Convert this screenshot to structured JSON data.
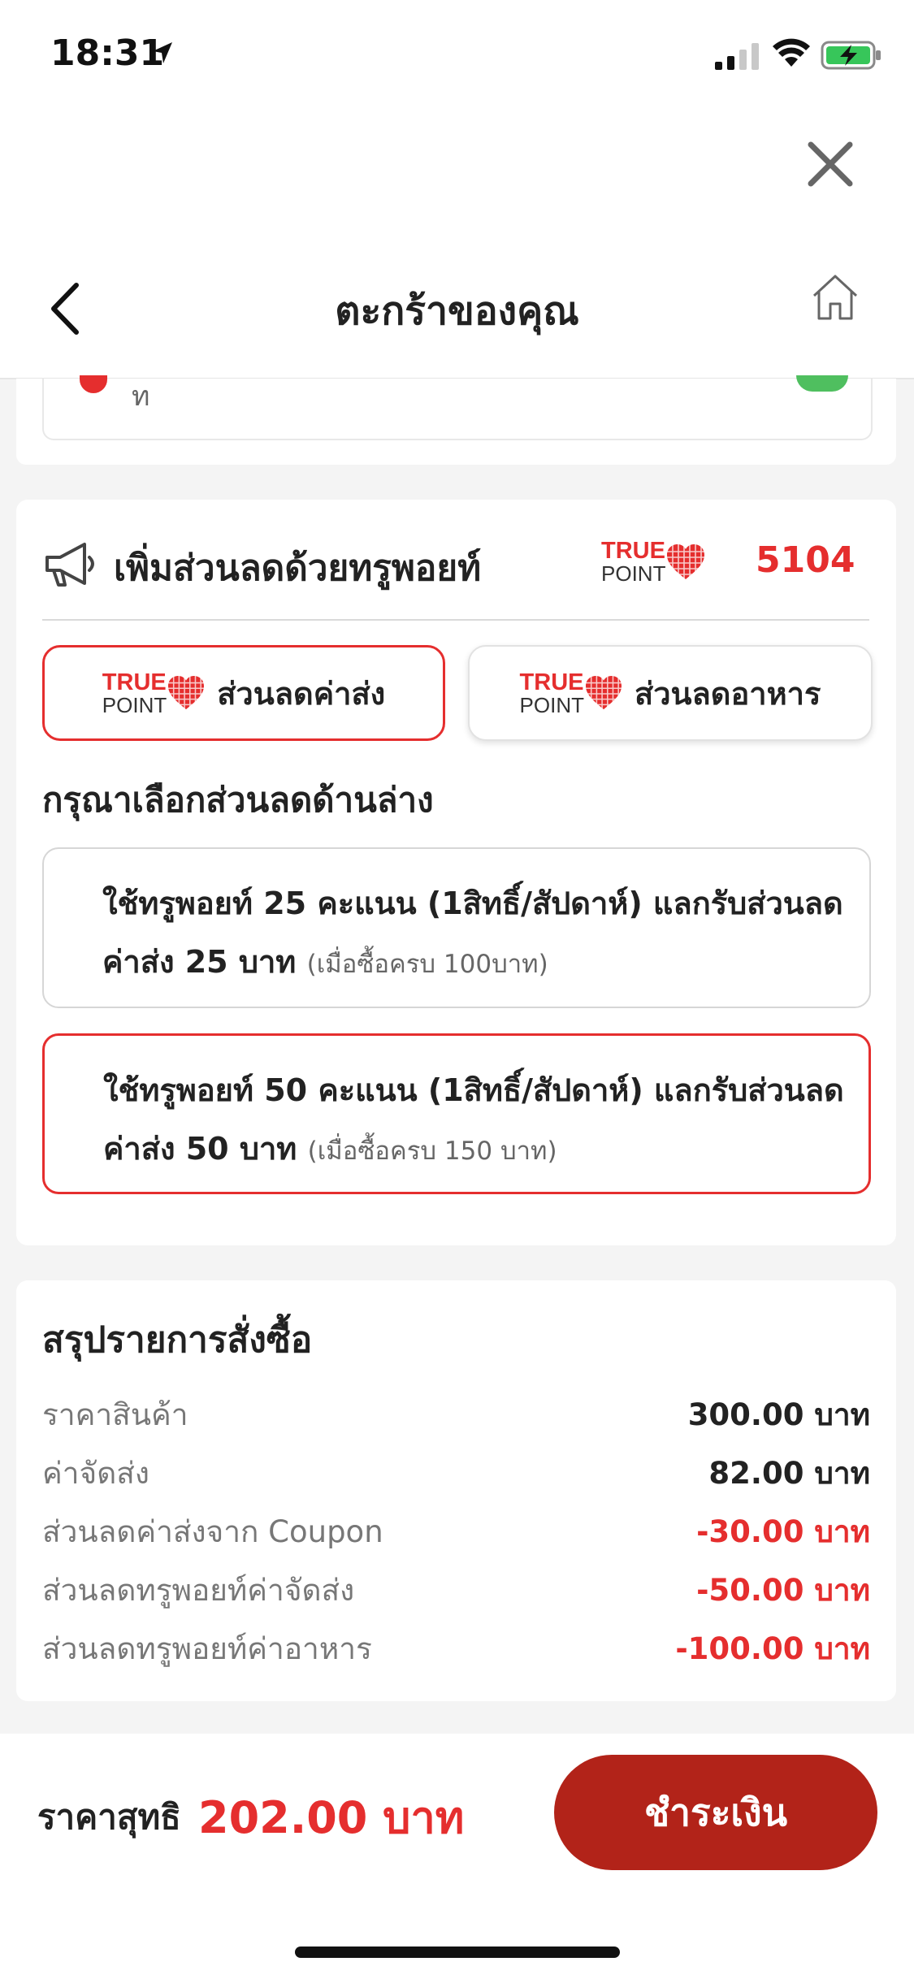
{
  "status_bar": {
    "time": "18:31"
  },
  "header": {
    "title": "ตะกร้าของคุณ"
  },
  "remnant": {
    "text": "ท"
  },
  "points_section": {
    "title": "เพิ่มส่วนลดด้วยทรูพอยท์",
    "logo_true": "TRUE",
    "logo_point": "POINT",
    "points": "5104",
    "tabs": [
      {
        "label": "ส่วนลดค่าส่ง",
        "active": true
      },
      {
        "label": "ส่วนลดอาหาร",
        "active": false
      }
    ],
    "prompt": "กรุณาเลือกส่วนลดด้านล่าง",
    "options": [
      {
        "line1": "ใช้ทรูพอยท์ 25 คะแนน (1สิทธิ์/สัปดาห์) แลกรับส่วนลด",
        "line2": "ค่าส่ง 25 บาท",
        "condition": "(เมื่อซื้อครบ 100บาท)",
        "selected": false
      },
      {
        "line1": "ใช้ทรูพอยท์ 50 คะแนน (1สิทธิ์/สัปดาห์) แลกรับส่วนลด",
        "line2": "ค่าส่ง 50 บาท",
        "condition": "(เมื่อซื้อครบ 150 บาท)",
        "selected": true
      }
    ]
  },
  "summary": {
    "title": "สรุปรายการสั่งซื้อ",
    "rows": [
      {
        "label": "ราคาสินค้า",
        "value": "300.00 บาท"
      },
      {
        "label": "ค่าจัดส่ง",
        "value": "82.00 บาท"
      },
      {
        "label": "ส่วนลดค่าส่งจาก Coupon",
        "value": "-30.00 บาท"
      },
      {
        "label": "ส่วนลดทรูพอยท์ค่าจัดส่ง",
        "value": "-50.00 บาท"
      },
      {
        "label": "ส่วนลดทรูพอยท์ค่าอาหาร",
        "value": "-100.00 บาท"
      }
    ]
  },
  "footer": {
    "net_label": "ราคาสุทธิ",
    "net_value": "202.00 บาท",
    "pay_label": "ชำระเงิน"
  },
  "colors": {
    "accent": "#e52e2e",
    "pay_button": "#b22319"
  }
}
